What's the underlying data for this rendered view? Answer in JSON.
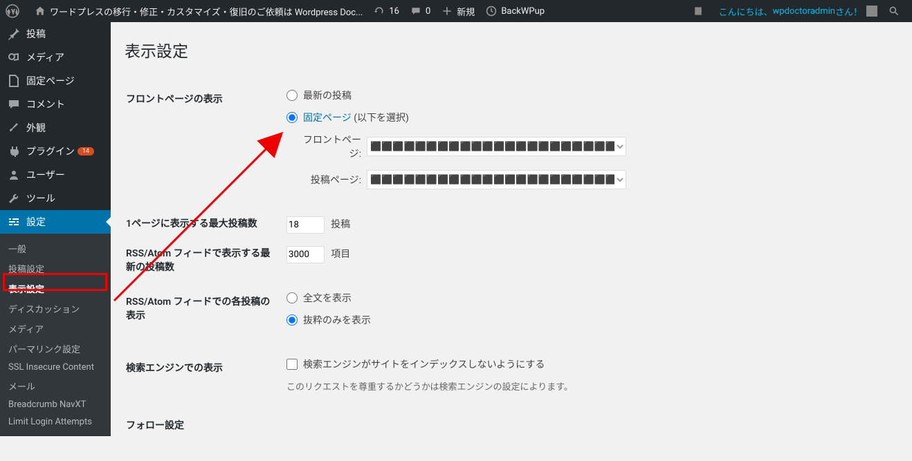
{
  "adminbar": {
    "site_title": "ワードプレスの移行・修正・カスタマイズ・復旧のご依頼は Wordpress Doc...",
    "updates": "16",
    "comments": "0",
    "new": "新規",
    "backwpup": "BackWPup",
    "greeting_pre": "こんにちは、",
    "greeting_user": "wpdoctoradmin",
    "greeting_post": " さん！"
  },
  "sidebar": {
    "posts": "投稿",
    "media": "メディア",
    "pages": "固定ページ",
    "comments": "コメント",
    "appearance": "外観",
    "plugins": "プラグイン",
    "plugins_badge": "14",
    "users": "ユーザー",
    "tools": "ツール",
    "settings": "設定",
    "sub": {
      "general": "一般",
      "writing": "投稿設定",
      "reading": "表示設定",
      "discussion": "ディスカッション",
      "media": "メディア",
      "permalink": "パーマリンク設定",
      "ssl": "SSL Insecure Content",
      "mail": "メール",
      "breadcrumb": "Breadcrumb NavXT",
      "lla": "Limit Login Attempts"
    }
  },
  "page": {
    "title": "表示設定",
    "front": {
      "th": "フロントページの表示",
      "opt_latest": "最新の投稿",
      "opt_static": "固定ページ",
      "opt_static_suffix": " (以下を選択)",
      "front_label": "フロントページ:",
      "posts_label": "投稿ページ:",
      "sel_blur": "⬛⬛⬛⬛⬛⬛⬛⬛⬛⬛⬛⬛⬛⬛⬛⬛⬛⬛⬛⬛⬛⬛⬛⬛"
    },
    "perpage": {
      "th": "1ページに表示する最大投稿数",
      "val": "18",
      "suffix": "投稿"
    },
    "rss_count": {
      "th": "RSS/Atom フィードで表示する最新の投稿数",
      "val": "3000",
      "suffix": "項目"
    },
    "rss_view": {
      "th": "RSS/Atom フィードでの各投稿の表示",
      "full": "全文を表示",
      "summary": "抜粋のみを表示"
    },
    "seo": {
      "th": "検索エンジンでの表示",
      "chk": "検索エンジンがサイトをインデックスしないようにする",
      "desc": "このリクエストを尊重するかどうかは検索エンジンの設定によります。"
    },
    "follow": {
      "th": "フォロー設定"
    }
  }
}
